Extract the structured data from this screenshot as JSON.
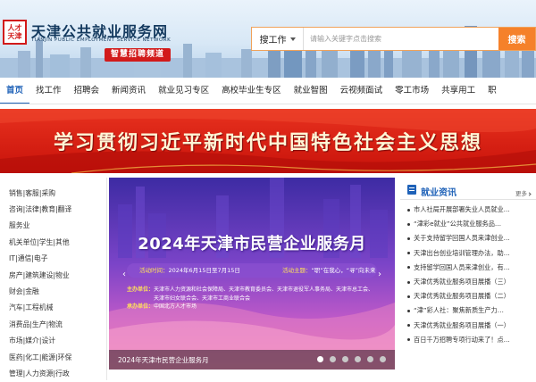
{
  "header": {
    "logo_text": "人才天津",
    "site_title": "天津公共就业服务网",
    "site_subtitle": "TIANJIN PUBLIC EMPLOYMENT SERVICE NETWORK",
    "channel_badge": "智慧招聘频道"
  },
  "search": {
    "type_label": "搜工作",
    "placeholder": "请输入关键字点击搜索",
    "button_label": "搜索"
  },
  "nav": {
    "items": [
      {
        "label": "首页",
        "active": true
      },
      {
        "label": "找工作"
      },
      {
        "label": "招聘会"
      },
      {
        "label": "新闻资讯"
      },
      {
        "label": "就业见习专区"
      },
      {
        "label": "高校毕业生专区"
      },
      {
        "label": "就业智图"
      },
      {
        "label": "云视频面试"
      },
      {
        "label": "零工市场"
      },
      {
        "label": "共享用工"
      },
      {
        "label": "职"
      }
    ]
  },
  "banner": {
    "text": "学习贯彻习近平新时代中国特色社会主义思想",
    "colors": {
      "bg": "#d4170d",
      "text": "#fff6d6"
    }
  },
  "side_menu": {
    "items": [
      "销售|客服|采购",
      "咨询|法律|教育|翻译",
      "服务业",
      "机关单位|学生|其他",
      "IT|通信|电子",
      "房产|建筑建设|物业",
      "财会|金融",
      "汽车|工程机械",
      "消费品|生产|物流",
      "市场|媒介|设计",
      "医药|化工|能源|环保",
      "管理|人力资源|行政"
    ]
  },
  "slider": {
    "title": "2024年天津市民营企业服务月",
    "time_label": "活动时间：",
    "time_value": "2024年6月15日至7月15日",
    "theme_label": "活动主题：",
    "theme_value": "“职”在我心，“寻”向未来",
    "organizer_label": "主办单位：",
    "organizer_lines": [
      "天津市人力资源和社会保障局、天津市教育委员会、天津市退役军人事务局、天津市总工会、",
      "天津市妇女联合会、天津市工商业联合会"
    ],
    "host_label": "承办单位：",
    "host_value": "中国北方人才市场",
    "caption": "2024年天津市民营企业服务月",
    "active_dot": 0,
    "dot_count": 6
  },
  "news": {
    "title": "就业资讯",
    "more_label": "更多",
    "items": [
      "市人社局开展部署失业人员就业…",
      "“津彩e就业”公共就业服务品…",
      "关于支持留学回国人员来津创业…",
      "天津出台创业培训管理办法，助…",
      "支持留学回国人员来津创业，有…",
      "天津优秀就业服务项目展播（三）",
      "天津优秀就业服务项目展播（二）",
      "“津”彩人社：聚焦新质生产力…",
      "天津优秀就业服务项目展播（一）",
      "百日千万招聘专项行动来了！点…"
    ]
  }
}
